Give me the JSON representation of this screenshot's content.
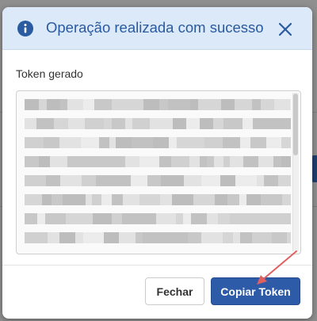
{
  "modal": {
    "title": "Operação realizada com sucesso",
    "token_label": "Token gerado",
    "token_value": "",
    "buttons": {
      "close_label": "Fechar",
      "copy_label": "Copiar Token"
    }
  },
  "icons": {
    "info": "info-circle-icon",
    "close": "close-x-icon"
  },
  "colors": {
    "header_bg": "#dbe9f9",
    "title_blue": "#2a5aa0",
    "primary_button": "#2d5ba7",
    "annotation_arrow": "#e06060"
  }
}
